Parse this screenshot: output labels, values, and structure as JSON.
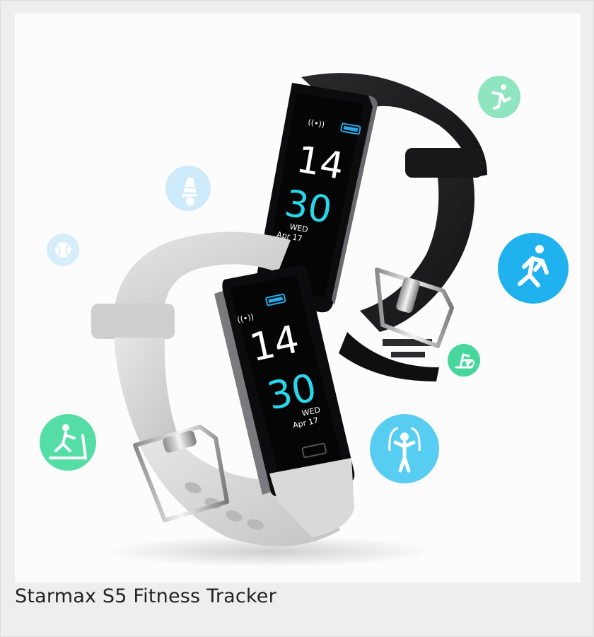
{
  "caption": "Starmax S5 Fitness Tracker",
  "colors": {
    "background": "#eeeeee",
    "photo_bg": "#fcfcfc",
    "black_band": "#1b1b1d",
    "gray_band": "#d4d4d4",
    "screen_teal": "#27d6e8",
    "icon_blue": "#1fb2ee",
    "icon_green": "#33d49a"
  },
  "black_tracker": {
    "hour": "14",
    "minute": "30",
    "day": "WED",
    "date": "Apr 17"
  },
  "gray_tracker": {
    "hour": "14",
    "minute": "30",
    "day": "WED",
    "date": "Apr 17"
  },
  "activity_icons": [
    "yoga-icon",
    "badminton-icon",
    "tennis-ball-icon",
    "running-icon",
    "exercise-bike-icon",
    "jump-rope-icon",
    "treadmill-icon"
  ]
}
